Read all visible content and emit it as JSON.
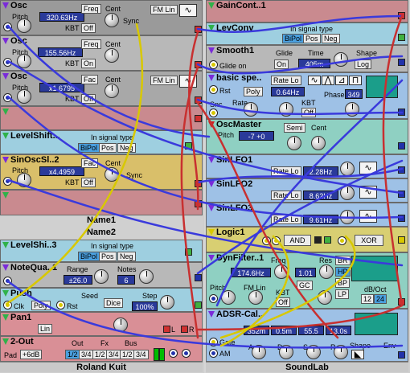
{
  "left": {
    "osc1": {
      "title": "Osc",
      "pitch": "Pitch",
      "freq_value": "320.63Hz",
      "freq_btn": "Freq",
      "cent": "Cent",
      "fm_lin": "FM Lin",
      "kbt": "KBT",
      "kbt_value": "Off",
      "sync": "Sync"
    },
    "osc2": {
      "title": "Osc",
      "pitch": "Pitch",
      "freq_value": "155.56Hz",
      "freq_btn": "Freq",
      "cent": "Cent",
      "kbt": "KBT",
      "kbt_value": "On"
    },
    "osc3": {
      "title": "Osc",
      "pitch": "Pitch",
      "freq_value": "x1.6795",
      "fac_btn": "Fac",
      "cent": "Cent",
      "fm_lin": "FM Lin",
      "kbt": "KBT",
      "kbt_value": "Off"
    },
    "levelshift": {
      "title": "LevelShift...",
      "label": "In signal type",
      "opts": [
        "BiPol",
        "Pos",
        "Neg"
      ]
    },
    "sinosc": {
      "title": "SinOscSl..2",
      "pitch": "Pitch",
      "fac_value": "x4.4959",
      "fac_btn": "Fac",
      "cent": "Cent",
      "kbt": "KBT",
      "kbt_value": "Off",
      "sync": "Sync"
    },
    "name1": "Name1",
    "name2": "Name2",
    "levelshift3": {
      "title": "LevelShi..3",
      "label": "In signal type",
      "opts": [
        "BiPol",
        "Pos",
        "Neg"
      ]
    },
    "notequa": {
      "title": "NoteQua..1",
      "range": "Range",
      "range_value": "±26.0",
      "notes": "Notes",
      "notes_value": "6"
    },
    "push": {
      "title": "Push",
      "clk": "Clk",
      "poly": "Poly",
      "rst": "Rst",
      "seed": "Seed",
      "dice": "Dice",
      "step": "Step",
      "step_value": "100%"
    },
    "pan": {
      "title": "Pan1",
      "lin": "Lin",
      "l": "L",
      "r": "R"
    },
    "out": {
      "title": "2-Out",
      "pad": "Pad",
      "pad_value": "+6dB",
      "out_label": "Out",
      "fx_label": "Fx",
      "bus_label": "Bus",
      "opts": [
        "1/2",
        "3/4",
        "1/2",
        "3/4",
        "1/2",
        "3/4"
      ]
    },
    "footer": "Roland Kuit"
  },
  "right": {
    "gaincont": {
      "title": "GainCont..1"
    },
    "levconv": {
      "title": "LevConv",
      "label": "In signal type",
      "opts": [
        "BiPol",
        "Pos",
        "Neg"
      ]
    },
    "smooth": {
      "title": "Smooth1",
      "glide_on": "Glide on",
      "glide": "Glide",
      "glide_value": "On",
      "time": "Time",
      "time_value": "405m",
      "shape": "Shape",
      "shape_value": "Log",
      "pitch": "Pitch"
    },
    "basicspe": {
      "title": "basic spe..",
      "rst": "Rst",
      "rate_lo": "Rate Lo",
      "poly": "Poly",
      "rate_value": "0.64Hz",
      "snc": "Snc",
      "rate": "Rate",
      "kbt": "KBT",
      "kbt_value": "Off",
      "phase": "Phase",
      "phase_value": "349"
    },
    "oscmaster": {
      "title": "OscMaster",
      "pitch": "Pitch",
      "pitch_value": "-7 +0",
      "semi": "Semi",
      "cent": "Cent"
    },
    "sinlfo1": {
      "title": "SinLFO1",
      "rate_lo": "Rate Lo",
      "value": "2.28Hz"
    },
    "sinlfo2": {
      "title": "SinLFO2",
      "rate_lo": "Rate Lo",
      "value": "8.62Hz"
    },
    "sinlfo3": {
      "title": "SinLFO3",
      "rate_lo": "Rate Lo",
      "value": "9.61Hz"
    },
    "logic": {
      "title": "Logic1",
      "op1": "AND",
      "op2": "XOR"
    },
    "dynfilter": {
      "title": "DynFilter..1",
      "freq": "Freq",
      "freq_value": "174.6Hz",
      "res": "Res",
      "res_value": "1.01",
      "gc": "GC",
      "pitch": "Pitch",
      "fm_lin": "FM Lin",
      "kbt": "KBT",
      "kbt_value": "Off",
      "modes": [
        "BR",
        "HP",
        "BP",
        "LP"
      ],
      "db_oct": "dB/Oct",
      "slopes": [
        "12",
        "24"
      ]
    },
    "adsr": {
      "title": "ADSR-Cal..",
      "a_value": "352m",
      "d_value": "0.5m",
      "s_value": "55.5",
      "r_value": "13.0s",
      "gate": "Gate",
      "am": "AM",
      "a": "A",
      "d": "D",
      "s": "S",
      "r": "R",
      "shape": "Shape",
      "env": "Env"
    },
    "footer": "SoundLab"
  }
}
